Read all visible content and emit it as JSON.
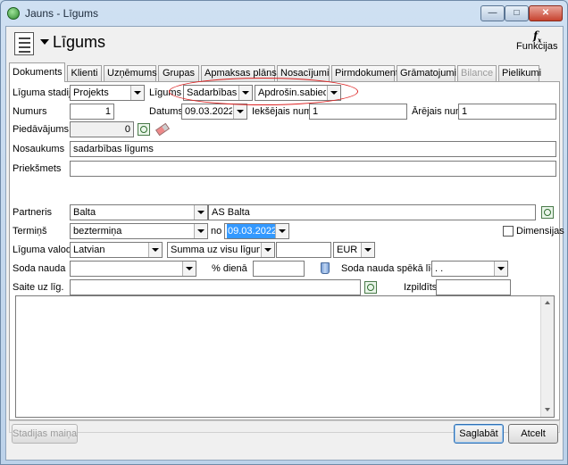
{
  "window": {
    "title": "Jauns - Līgums"
  },
  "header": {
    "title": "Līgums",
    "functions_label": "Funkcijas",
    "functions_icon": "fx-icon"
  },
  "tabs": [
    {
      "label": "Dokuments",
      "active": true
    },
    {
      "label": "Klienti"
    },
    {
      "label": "Uzņēmums"
    },
    {
      "label": "Grupas"
    },
    {
      "label": "Apmaksas plāns"
    },
    {
      "label": "Nosacījumi"
    },
    {
      "label": "Pirmdokumenti"
    },
    {
      "label": "Grāmatojumi"
    },
    {
      "label": "Bilance",
      "disabled": true
    },
    {
      "label": "Pielikumi"
    }
  ],
  "form": {
    "stadija": {
      "label": "Līguma stadija",
      "value": "Projekts"
    },
    "ligums": {
      "label": "Līgums",
      "type_value": "Sadarbības",
      "subtype_value": "Apdrošin.sabiedrība"
    },
    "numurs": {
      "label": "Numurs",
      "value": "1"
    },
    "datums": {
      "label": "Datums",
      "value": "09.03.2022"
    },
    "iekseja": {
      "label": "Iekšējais num.",
      "value": "1"
    },
    "areja": {
      "label": "Ārējais num.",
      "value": "1"
    },
    "piedavajums": {
      "label": "Piedāvājums",
      "value": "0"
    },
    "nosaukums": {
      "label": "Nosaukums",
      "value": "sadarbības līgums"
    },
    "prieksmets": {
      "label": "Priekšmets",
      "value": ""
    },
    "partneris": {
      "label": "Partneris",
      "value": "Balta",
      "name_value": "AS Balta"
    },
    "termins": {
      "label": "Termiņš",
      "value": "beztermiņa",
      "no_label": "no",
      "no_value": "09.03.2022"
    },
    "dimensijas": {
      "label": "Dimensijas",
      "checked": false
    },
    "valoda": {
      "label": "Līguma valoda",
      "value": "Latvian",
      "summa_value": "Summa uz visu līgumu",
      "amount_value": "",
      "currency_value": "EUR"
    },
    "soda": {
      "label": "Soda nauda",
      "value": "",
      "percent_label": "% dienā",
      "percent_value": "",
      "speka_label": "Soda nauda spēkā līdz",
      "speka_value": ". ."
    },
    "saite": {
      "label": "Saite uz līg.",
      "value": "",
      "izpildits_label": "Izpildīts",
      "izpildits_value": ""
    }
  },
  "buttons": {
    "stadijas": "Stadijas maiņa",
    "saglabat": "Saglabāt",
    "atcelt": "Atcelt"
  },
  "colors": {
    "highlight": "#3399ff",
    "annotation": "#dd2222"
  }
}
